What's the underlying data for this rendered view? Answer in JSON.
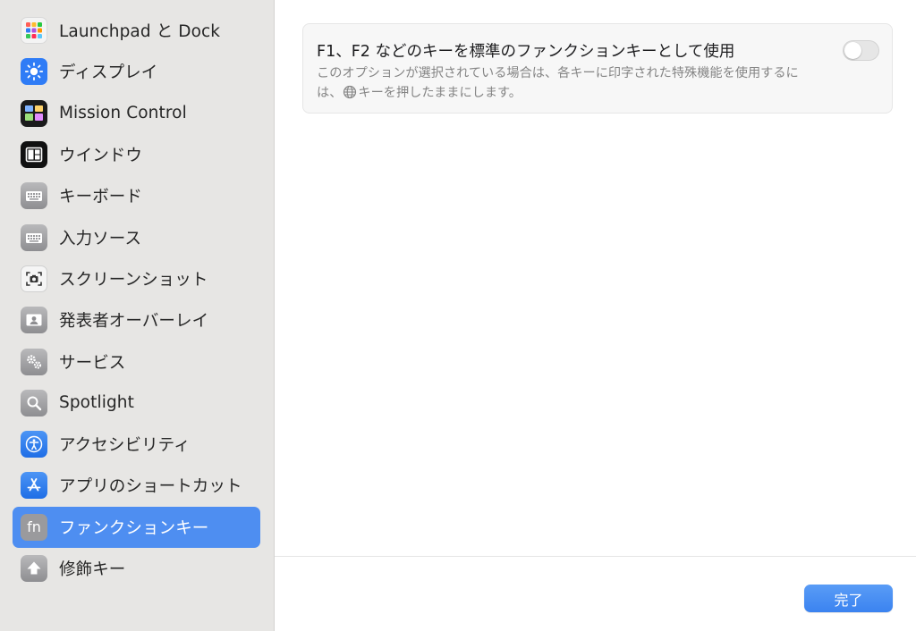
{
  "sidebar": {
    "items": [
      {
        "label": "Launchpad と Dock",
        "icon": "launchpad-icon"
      },
      {
        "label": "ディスプレイ",
        "icon": "brightness-icon"
      },
      {
        "label": "Mission Control",
        "icon": "mission-control-icon"
      },
      {
        "label": "ウインドウ",
        "icon": "window-icon"
      },
      {
        "label": "キーボード",
        "icon": "keyboard-icon"
      },
      {
        "label": "入力ソース",
        "icon": "keyboard-icon"
      },
      {
        "label": "スクリーンショット",
        "icon": "screenshot-icon"
      },
      {
        "label": "発表者オーバーレイ",
        "icon": "presenter-icon"
      },
      {
        "label": "サービス",
        "icon": "gears-icon"
      },
      {
        "label": "Spotlight",
        "icon": "magnifier-icon"
      },
      {
        "label": "アクセシビリティ",
        "icon": "accessibility-icon"
      },
      {
        "label": "アプリのショートカット",
        "icon": "app-store-icon"
      },
      {
        "label": "ファンクションキー",
        "icon": "fn-icon",
        "icon_text": "fn",
        "selected": true
      },
      {
        "label": "修飾キー",
        "icon": "modifier-arrow-icon"
      }
    ]
  },
  "main": {
    "option": {
      "title": "F1、F2 などのキーを標準のファンクションキーとして使用",
      "description_part1": "このオプションが選択されている場合は、各キーに印字された特殊機能を使用するには、",
      "description_icon": "globe-icon",
      "description_part2": "キーを押したままにします。",
      "toggle_on": false
    },
    "done_label": "完了"
  },
  "colors": {
    "sidebar_bg": "#e7e6e4",
    "selection": "#4e8ef1",
    "accent_button": "#3b83f0"
  }
}
